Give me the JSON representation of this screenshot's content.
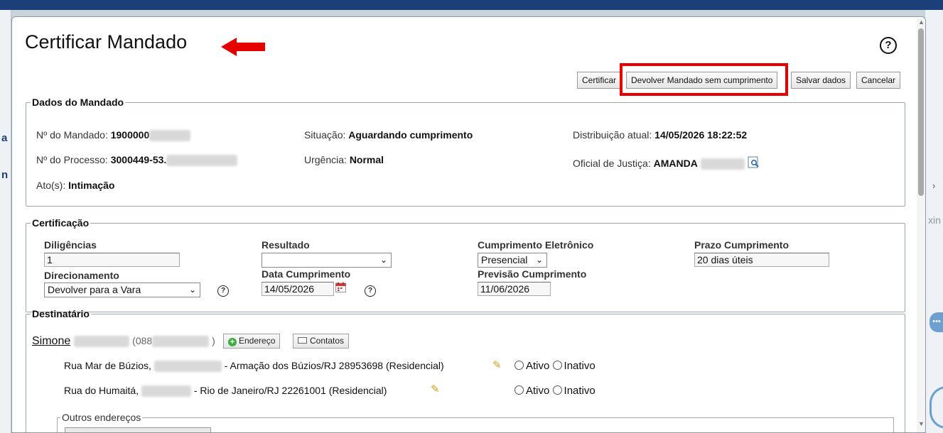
{
  "background": {
    "left_fragments": [
      "a",
      "n"
    ],
    "right_fragment": "xin",
    "right_chevron": "›",
    "right_dots": "•••"
  },
  "dialog": {
    "title": "Certificar Mandado",
    "help_glyph": "?",
    "accent_color": "#e60000",
    "buttons": {
      "certificar": "Certificar",
      "devolver": "Devolver Mandado sem cumprimento",
      "salvar": "Salvar dados",
      "cancelar": "Cancelar"
    }
  },
  "dados": {
    "legend": "Dados do Mandado",
    "mandado_label": "Nº do Mandado:",
    "mandado_value": "1900000",
    "processo_label": "Nº do Processo:",
    "processo_value": "3000449-53.",
    "atos_label": "Ato(s):",
    "atos_value": "Intimação",
    "situacao_label": "Situação:",
    "situacao_value": "Aguardando cumprimento",
    "urgencia_label": "Urgência:",
    "urgencia_value": "Normal",
    "distribuicao_label": "Distribuição atual:",
    "distribuicao_value": "14/05/2026 18:22:52",
    "oficial_label": "Oficial de Justiça:",
    "oficial_value": "AMANDA",
    "oficial_icon": "magnifier-icon"
  },
  "certificacao": {
    "legend": "Certificação",
    "diligencias_label": "Diligências",
    "diligencias_value": "1",
    "resultado_label": "Resultado",
    "resultado_value": "",
    "cumprimento_label": "Cumprimento Eletrônico",
    "cumprimento_value": "Presencial",
    "prazo_label": "Prazo Cumprimento",
    "prazo_value": "20 dias úteis",
    "direcionamento_label": "Direcionamento",
    "direcionamento_value": "Devolver para a Vara",
    "data_label": "Data Cumprimento",
    "data_value": "14/05/2026",
    "previsao_label": "Previsão Cumprimento",
    "previsao_value": "11/06/2026"
  },
  "destinatario": {
    "legend": "Destinatário",
    "name": "Simone",
    "doc_prefix": "(088",
    "doc_suffix": ")",
    "endereco_button": "Endereço",
    "contatos_button": "Contatos",
    "addresses": [
      {
        "street": "Rua Mar de Búzios,",
        "city": "- Armação dos Búzios/RJ 28953698 (Residencial)"
      },
      {
        "street": "Rua do Humaitá,",
        "city": "- Rio de Janeiro/RJ 22261001 (Residencial)"
      }
    ],
    "ativo_label": "Ativo",
    "inativo_label": "Inativo",
    "outros_legend": "Outros endereços"
  }
}
